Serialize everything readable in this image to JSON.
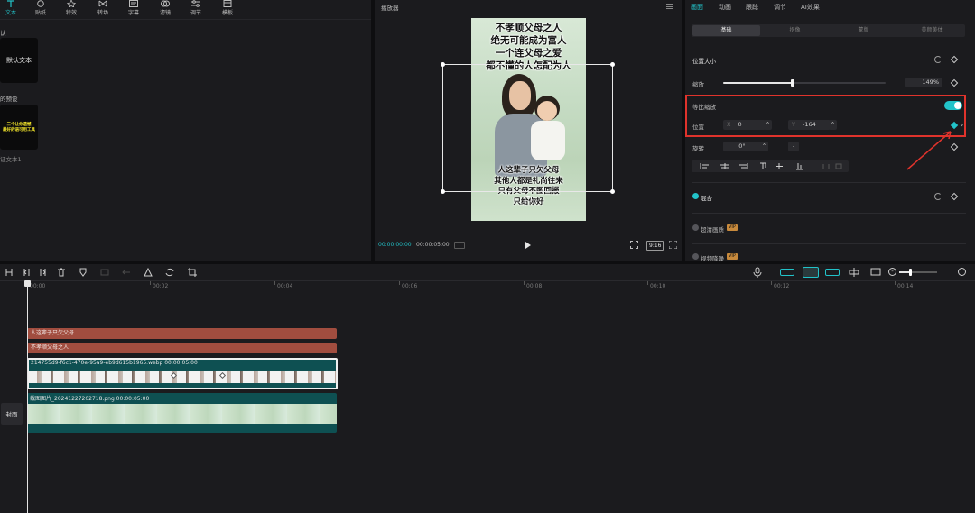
{
  "toolbar": {
    "items": [
      {
        "label": "文本",
        "icon": "text-icon"
      },
      {
        "label": "贴纸",
        "icon": "sticker-icon"
      },
      {
        "label": "特效",
        "icon": "effects-icon"
      },
      {
        "label": "转场",
        "icon": "transition-icon"
      },
      {
        "label": "字幕",
        "icon": "caption-icon"
      },
      {
        "label": "滤镜",
        "icon": "filter-icon"
      },
      {
        "label": "调节",
        "icon": "adjust-icon"
      },
      {
        "label": "模板",
        "icon": "template-icon"
      }
    ]
  },
  "left_panel": {
    "section1": "认",
    "default_text": "默认文本",
    "section2": "的预设",
    "preset_line1": "三个让你遗憾",
    "preset_line2": "最好的语可用工具",
    "preset_caption": "证文本1"
  },
  "player": {
    "title": "播放器",
    "poster_top": [
      "不孝顺父母之人",
      "绝无可能成为富人",
      "一个连父母之爱",
      "都不懂的人怎配为人"
    ],
    "poster_bottom": [
      "人这辈子只欠父母",
      "其他人都是礼尚往来",
      "只有父母不图回报",
      "只给你好"
    ],
    "time_current": "00:00:00:00",
    "time_total": "00:00:05:00",
    "ratio": "9:16"
  },
  "right_panel": {
    "tabs": [
      "画面",
      "动画",
      "跟踪",
      "调节",
      "AI效果"
    ],
    "subtabs": [
      "基础",
      "抠像",
      "蒙版",
      "美颜美体"
    ],
    "position_size": "位置大小",
    "scale_label": "缩放",
    "scale_value": "149%",
    "scale_fraction": 0.43,
    "uniform_scale": "等比缩放",
    "position_label": "位置",
    "x_label": "X",
    "x_value": "0",
    "y_label": "Y",
    "y_value": "-164",
    "rotate_label": "旋转",
    "rotate_value": "0°",
    "rotate_extra": "-",
    "blend": "混合",
    "super_res": "超清画质",
    "denoise": "视频降噪",
    "vip": "VIP"
  },
  "timeline": {
    "ruler": [
      "00:00",
      "00:02",
      "00:04",
      "00:06",
      "00:08",
      "00:10",
      "00:12",
      "00:14"
    ],
    "text_clip1": "人这辈子只欠父母",
    "text_clip2": "不孝顺父母之人",
    "video_clip": "214755d9-f6c1-470e-95a9-eb9d615b1965.webp  00:00:05:00",
    "image_clip": "截图图片_20241227202718.png  00:00:05:00",
    "cover": "封面"
  },
  "colors": {
    "accent": "#22c3c9",
    "highlight": "#e0332c",
    "text_clip": "#a14d3f",
    "video_track": "#0e5052"
  }
}
